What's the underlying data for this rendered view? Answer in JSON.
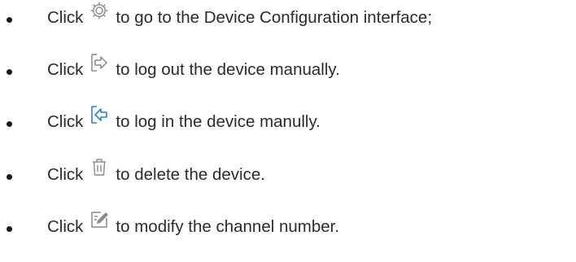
{
  "items": [
    {
      "click": "Click",
      "icon": "gear-icon",
      "text": "to go to the Device Configuration interface;"
    },
    {
      "click": "Click",
      "icon": "logout-icon",
      "text": "to log out the device manually."
    },
    {
      "click": "Click",
      "icon": "login-icon",
      "text": " to log in the device manully."
    },
    {
      "click": "Click",
      "icon": "trash-icon",
      "text": "to delete the device."
    },
    {
      "click": "Click",
      "icon": "edit-channel-icon",
      "text": "to modify the channel number."
    }
  ],
  "colors": {
    "icon_gray": "#8a8a8a",
    "icon_blue": "#2f7fd6",
    "text": "#2b2b2b"
  }
}
